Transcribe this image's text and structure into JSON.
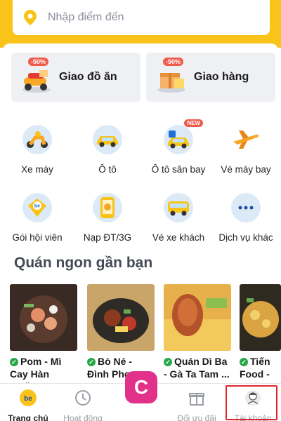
{
  "search": {
    "placeholder": "Nhập điểm đến"
  },
  "cards": [
    {
      "label": "Giao đồ ăn",
      "badge": "-50%",
      "icon": "food-delivery-icon"
    },
    {
      "label": "Giao hàng",
      "badge": "-50%",
      "icon": "package-delivery-icon"
    }
  ],
  "services": [
    {
      "label": "Xe máy",
      "icon": "motorbike-icon"
    },
    {
      "label": "Ô tô",
      "icon": "car-icon"
    },
    {
      "label": "Ô tô sân bay",
      "icon": "airport-car-icon",
      "badge": "NEW"
    },
    {
      "label": "Vé máy bay",
      "icon": "airplane-icon"
    },
    {
      "label": "Gói hội viên",
      "icon": "membership-icon"
    },
    {
      "label": "Nạp ĐT/3G",
      "icon": "topup-icon"
    },
    {
      "label": "Vé xe khách",
      "icon": "bus-icon"
    },
    {
      "label": "Dịch vụ khác",
      "icon": "more-icon"
    }
  ],
  "section_title": "Quán ngon gần bạn",
  "restaurants": [
    {
      "line1": "Pom - Mì",
      "line2": "Cay Hàn Quố..."
    },
    {
      "line1": "Bò Né -",
      "line2": "Đình Phong ..."
    },
    {
      "line1": "Quán Dì Ba",
      "line2": "- Gà Ta Tam ..."
    },
    {
      "line1": "Tiến",
      "line2": "Food -"
    }
  ],
  "nav": [
    {
      "label": "Trang chủ",
      "icon": "home-icon",
      "active": true
    },
    {
      "label": "Hoạt động",
      "icon": "activity-icon",
      "active": false
    },
    {
      "label": "Đổi ưu đãi",
      "icon": "gift-icon",
      "active": false
    },
    {
      "label": "Tài khoản",
      "icon": "account-icon",
      "active": false
    }
  ],
  "center_button": {
    "label": "C"
  },
  "colors": {
    "brand_yellow": "#f9c31a",
    "highlight_red": "#e0262d",
    "center_pink": "#e2318b"
  }
}
